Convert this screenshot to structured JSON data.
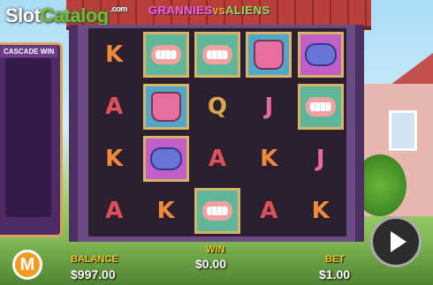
{
  "watermark": {
    "slot": "Slot",
    "catalog": "Catalog",
    "com": ".com"
  },
  "game_title": {
    "grannies": "GRANNIES",
    "vs": "VS",
    "aliens": "ALIENS"
  },
  "cascade_panel": {
    "title": "CASCADE WIN"
  },
  "grid": [
    [
      {
        "type": "letter",
        "text": "K",
        "color": "#f08a3a",
        "tile": ""
      },
      {
        "type": "teeth",
        "tile": "green"
      },
      {
        "type": "teeth",
        "tile": "green"
      },
      {
        "type": "bag",
        "tile": "blue"
      },
      {
        "type": "slipper",
        "tile": "pink"
      }
    ],
    [
      {
        "type": "letter",
        "text": "A",
        "color": "#e0505a",
        "tile": ""
      },
      {
        "type": "bag",
        "tile": "blue"
      },
      {
        "type": "letter",
        "text": "Q",
        "color": "#d9a84a",
        "tile": ""
      },
      {
        "type": "letter",
        "text": "J",
        "color": "#e86aa0",
        "tile": ""
      },
      {
        "type": "teeth",
        "tile": "green"
      }
    ],
    [
      {
        "type": "letter",
        "text": "K",
        "color": "#f08a3a",
        "tile": ""
      },
      {
        "type": "slipper",
        "tile": "pink"
      },
      {
        "type": "letter",
        "text": "A",
        "color": "#e0505a",
        "tile": ""
      },
      {
        "type": "letter",
        "text": "K",
        "color": "#f08a3a",
        "tile": ""
      },
      {
        "type": "letter",
        "text": "J",
        "color": "#e86aa0",
        "tile": ""
      }
    ],
    [
      {
        "type": "letter",
        "text": "A",
        "color": "#e0505a",
        "tile": ""
      },
      {
        "type": "letter",
        "text": "K",
        "color": "#f08a3a",
        "tile": ""
      },
      {
        "type": "teeth",
        "tile": "green"
      },
      {
        "type": "letter",
        "text": "A",
        "color": "#e0505a",
        "tile": ""
      },
      {
        "type": "letter",
        "text": "K",
        "color": "#f08a3a",
        "tile": ""
      }
    ]
  ],
  "footer": {
    "balance_label": "BALANCE",
    "balance_value": "$997.00",
    "win_label": "WIN",
    "win_value": "$0.00",
    "bet_label": "BET",
    "bet_value": "$1.00",
    "provider_logo": "M"
  }
}
